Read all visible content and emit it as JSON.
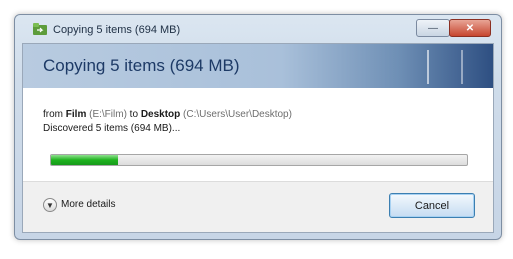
{
  "window": {
    "title": "Copying 5 items (694 MB)",
    "minimize_glyph": "—",
    "close_glyph": "✕"
  },
  "banner": {
    "heading": "Copying 5 items (694 MB)"
  },
  "details": {
    "from_prefix": "from ",
    "source_name": "Film",
    "source_path": "(E:\\Film)",
    "to_word": " to ",
    "dest_name": "Desktop",
    "dest_path": "(C:\\Users\\User\\Desktop)",
    "status": "Discovered 5 items (694 MB)..."
  },
  "progress": {
    "value_percent": 16,
    "color": "#1fb31f"
  },
  "footer": {
    "more_details_label": "More details",
    "more_details_icon": "chevron-down-circle-icon",
    "cancel_label": "Cancel"
  }
}
